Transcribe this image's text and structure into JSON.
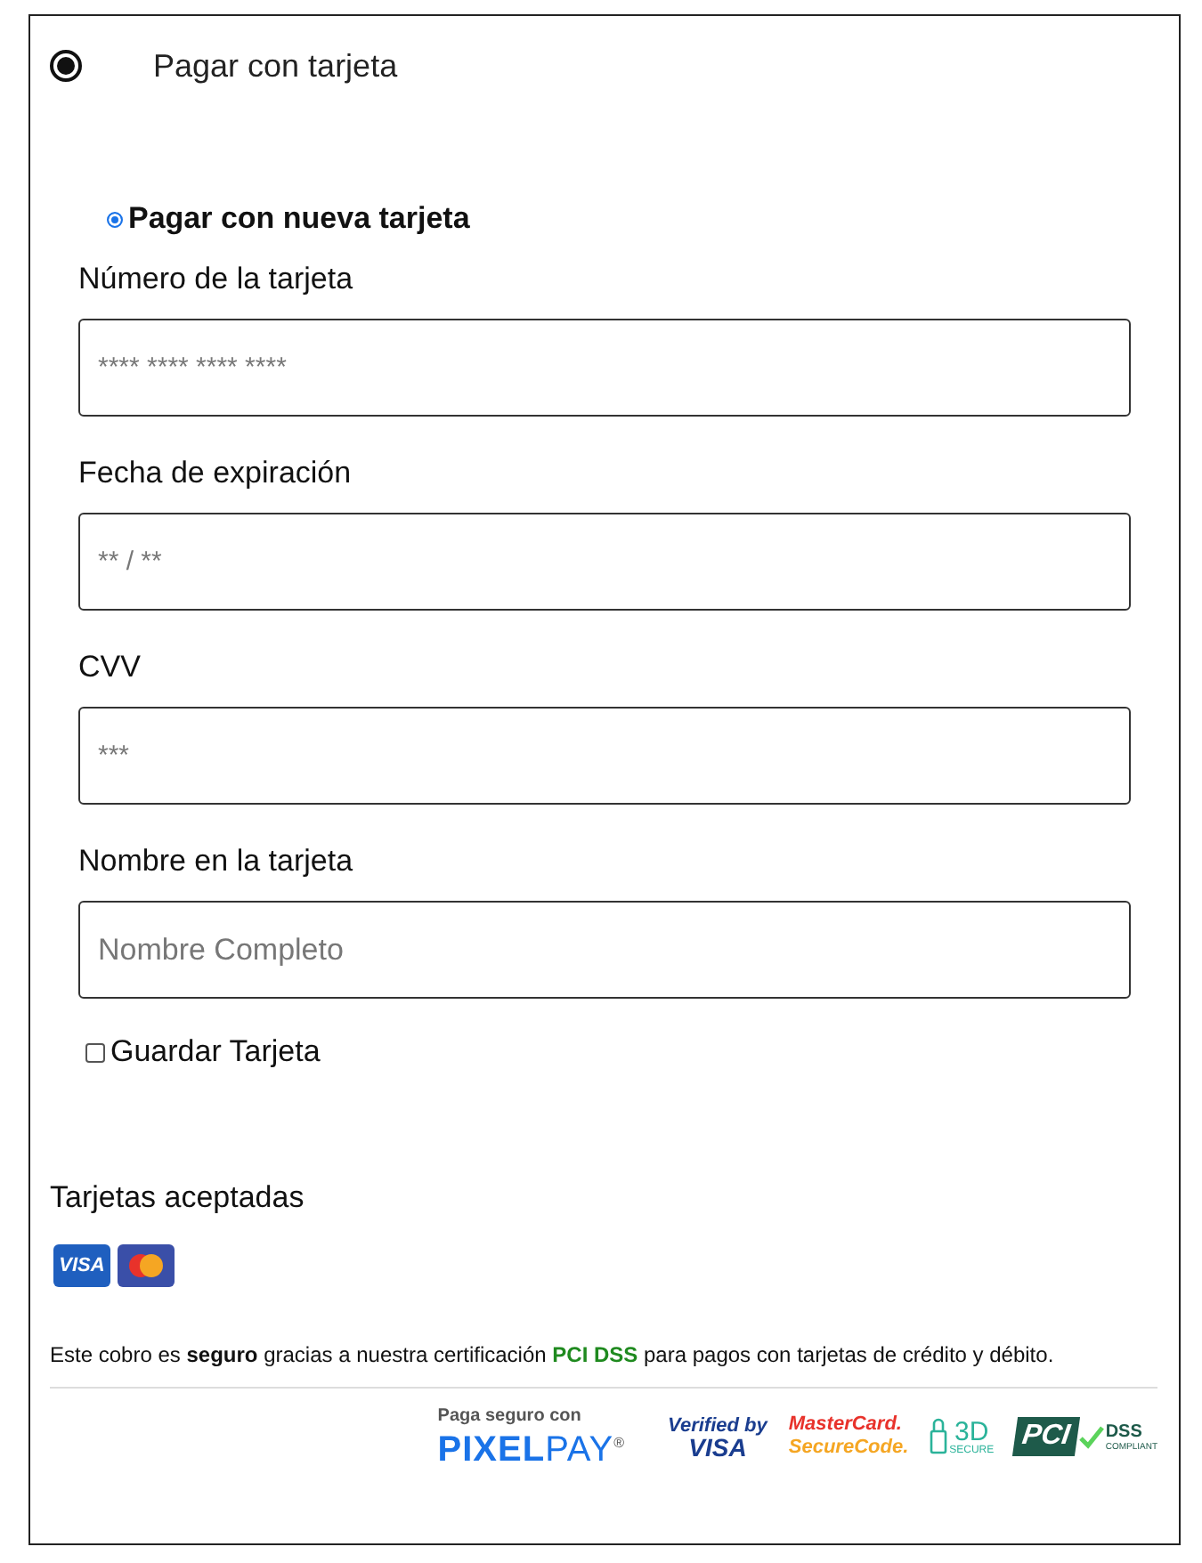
{
  "payment_option": {
    "label": "Pagar con tarjeta",
    "selected": true
  },
  "card_option": {
    "label": "Pagar con nueva tarjeta",
    "selected": true
  },
  "fields": [
    {
      "label": "Número de la tarjeta",
      "placeholder": "**** **** **** ****"
    },
    {
      "label": "Fecha de expiración",
      "placeholder": "** / **"
    },
    {
      "label": "CVV",
      "placeholder": "***"
    },
    {
      "label": "Nombre en la tarjeta",
      "placeholder": "Nombre Completo"
    }
  ],
  "save_card": {
    "label": "Guardar Tarjeta",
    "checked": false
  },
  "accepted_cards": {
    "title": "Tarjetas aceptadas",
    "cards": [
      {
        "kind": "visa",
        "label": "VISA"
      },
      {
        "kind": "mastercard"
      }
    ]
  },
  "security_note": [
    {
      "kind": "plain",
      "text": "Este cobro es "
    },
    {
      "kind": "bold",
      "text": "seguro"
    },
    {
      "kind": "plain",
      "text": " gracias a nuestra certificación "
    },
    {
      "kind": "highlight",
      "text": "PCI DSS"
    },
    {
      "kind": "plain",
      "text": " para pagos con tarjetas de crédito y débito."
    }
  ],
  "badges": [
    {
      "kind": "pixelpay",
      "top": "Paga seguro con",
      "brand_a": "PIXEL",
      "brand_b": "PAY",
      "mark": "®"
    },
    {
      "kind": "verified_visa",
      "top": "Verified by",
      "bottom": "VISA"
    },
    {
      "kind": "securecode",
      "top": "MasterCard.",
      "bottom": "SecureCode."
    },
    {
      "kind": "secure3d",
      "top": "3D",
      "bottom": "SECURE"
    },
    {
      "kind": "pci",
      "top": "PCI",
      "side": "DSS",
      "bottom": "COMPLIANT"
    }
  ]
}
